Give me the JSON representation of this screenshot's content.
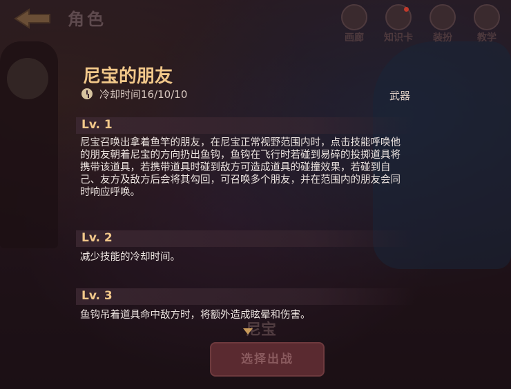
{
  "header": {
    "back_label": "",
    "title": "角色",
    "nav": [
      {
        "label": "画廊",
        "icon": "gallery-icon"
      },
      {
        "label": "知识卡",
        "icon": "card-icon"
      },
      {
        "label": "装扮",
        "icon": "outfit-icon"
      },
      {
        "label": "教学",
        "icon": "tutorial-icon"
      }
    ]
  },
  "skill": {
    "name": "尼宝的朋友",
    "cooldown": "冷却时间16/10/10",
    "category": "武器",
    "levels": [
      {
        "label": "Lv. 1",
        "text": "尼宝召唤出拿着鱼竿的朋友，在尼宝正常视野范围内时，点击技能呼唤他的朋友朝着尼宝的方向扔出鱼钩，鱼钩在飞行时若碰到易碎的投掷道具将携带该道具，若携带道具时碰到敌方可造成道具的碰撞效果，若碰到自己、友方及敌方后会将其勾回，可召唤多个朋友，并在范围内的朋友会同时响应呼唤。"
      },
      {
        "label": "Lv. 2",
        "text": "减少技能的冷却时间。"
      },
      {
        "label": "Lv. 3",
        "text": "鱼钩吊着道具命中敌方时，将额外造成眩晕和伤害。"
      }
    ]
  },
  "background": {
    "character_name": "尼宝",
    "select_button": "选择出战"
  },
  "colors": {
    "accent": "#f2c88a",
    "text": "#ece4e0"
  }
}
